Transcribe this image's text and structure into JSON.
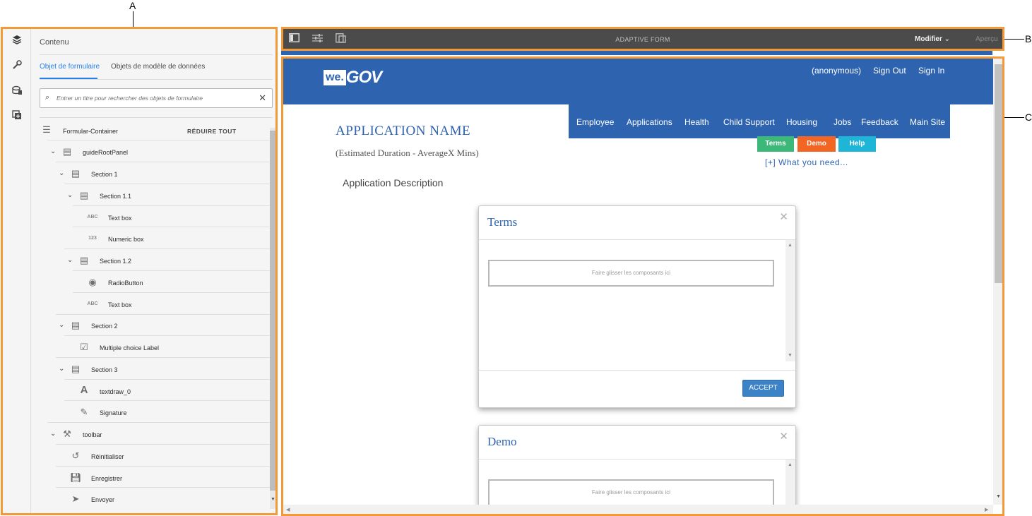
{
  "callouts": {
    "a": "A",
    "b": "B",
    "c": "C"
  },
  "sidebar": {
    "title": "Contenu",
    "tabs": [
      {
        "label": "Objet de formulaire",
        "active": true
      },
      {
        "label": "Objets de modèle de données",
        "active": false
      }
    ],
    "search": {
      "placeholder": "Entrer un titre pour rechercher des objets de formulaire"
    },
    "collapse_all": "RÉDUIRE TOUT",
    "tree": [
      {
        "label": "Formular-Container",
        "icon": "container-icon"
      },
      {
        "label": "guideRootPanel",
        "icon": "panel-icon"
      },
      {
        "label": "Section 1",
        "icon": "panel-icon"
      },
      {
        "label": "Section 1.1",
        "icon": "panel-icon"
      },
      {
        "label": "Text box",
        "icon": "ABC"
      },
      {
        "label": "Numeric box",
        "icon": "123"
      },
      {
        "label": "Section 1.2",
        "icon": "panel-icon"
      },
      {
        "label": "RadioButton",
        "icon": "radio-icon"
      },
      {
        "label": "Text box",
        "icon": "ABC"
      },
      {
        "label": "Section 2",
        "icon": "panel-icon"
      },
      {
        "label": "Multiple choice Label",
        "icon": "checkbox-icon"
      },
      {
        "label": "Section 3",
        "icon": "panel-icon"
      },
      {
        "label": "textdraw_0",
        "icon": "text-icon"
      },
      {
        "label": "Signature",
        "icon": "signature-icon"
      },
      {
        "label": "toolbar",
        "icon": "toolbar-icon"
      },
      {
        "label": "Réinitialiser",
        "icon": "reset-icon"
      },
      {
        "label": "Enregistrer",
        "icon": "save-icon"
      },
      {
        "label": "Envoyer",
        "icon": "send-icon"
      }
    ]
  },
  "toolbar": {
    "title": "ADAPTIVE FORM",
    "mode": "Modifier",
    "preview": "Aperçu"
  },
  "preview": {
    "logo": {
      "we": "we.",
      "gov": "GOV"
    },
    "header_links": [
      "(anonymous)",
      "Sign Out",
      "Sign In"
    ],
    "nav": [
      "Employee",
      "Applications",
      "Health",
      "Child Support",
      "Housing",
      "Jobs",
      "Feedback",
      "Main Site"
    ],
    "app_name": "APPLICATION NAME",
    "duration": "(Estimated Duration - AverageX Mins)",
    "description": "Application Description",
    "pills": [
      {
        "label": "Terms",
        "color": "#3cb878"
      },
      {
        "label": "Demo",
        "color": "#f26522"
      },
      {
        "label": "Help",
        "color": "#1fb5d6"
      }
    ],
    "what_you_need": "[+] What you need...",
    "modals": [
      {
        "title": "Terms",
        "drop_text": "Faire glisser les composants ici",
        "button": "ACCEPT"
      },
      {
        "title": "Demo",
        "drop_text": "Faire glisser les composants ici"
      }
    ]
  },
  "colors": {
    "highlight": "#f29a38",
    "brand_blue": "#2e63b0",
    "toolbar_bg": "#4b4b4b",
    "accent_blue": "#2680eb"
  }
}
